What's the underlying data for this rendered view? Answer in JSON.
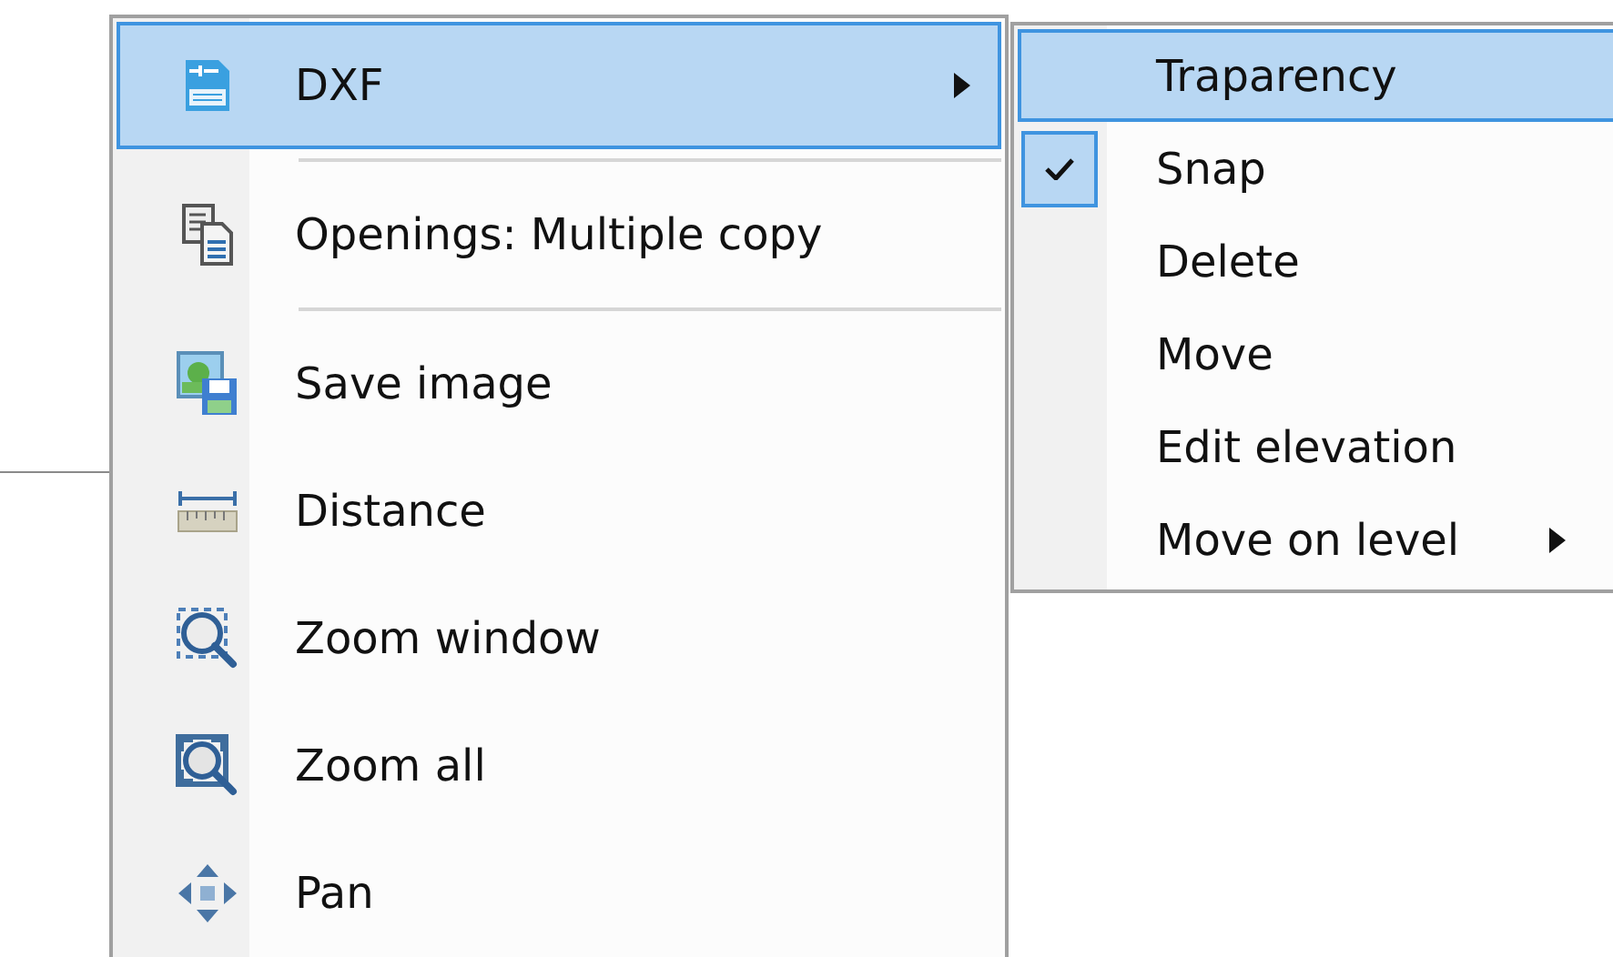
{
  "context_menu": {
    "items": [
      {
        "kind": "command",
        "label": "DXF",
        "selected": true,
        "has_submenu": true
      },
      {
        "kind": "separator"
      },
      {
        "kind": "command",
        "label": "Openings: Multiple copy",
        "selected": false,
        "has_submenu": false
      },
      {
        "kind": "separator"
      },
      {
        "kind": "command",
        "label": "Save image",
        "selected": false,
        "has_submenu": false
      },
      {
        "kind": "command",
        "label": "Distance",
        "selected": false,
        "has_submenu": false
      },
      {
        "kind": "command",
        "label": "Zoom window",
        "selected": false,
        "has_submenu": false
      },
      {
        "kind": "command",
        "label": "Zoom all",
        "selected": false,
        "has_submenu": false
      },
      {
        "kind": "command",
        "label": "Pan",
        "selected": false,
        "has_submenu": false
      }
    ]
  },
  "submenu": {
    "items": [
      {
        "label": "Traparency",
        "selected": true,
        "checked": false,
        "has_submenu": false
      },
      {
        "label": "Snap",
        "selected": false,
        "checked": true,
        "has_submenu": false
      },
      {
        "label": "Delete",
        "selected": false,
        "checked": false,
        "has_submenu": false
      },
      {
        "label": "Move",
        "selected": false,
        "checked": false,
        "has_submenu": false
      },
      {
        "label": "Edit elevation",
        "selected": false,
        "checked": false,
        "has_submenu": false
      },
      {
        "label": "Move on level",
        "selected": false,
        "checked": false,
        "has_submenu": true
      }
    ]
  }
}
